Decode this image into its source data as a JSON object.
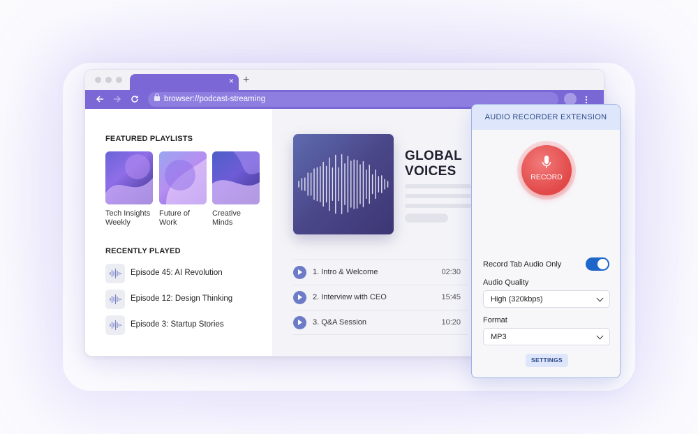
{
  "browser": {
    "url": "browser://podcast-streaming",
    "nav_icons": [
      "back-arrow-icon",
      "forward-arrow-icon",
      "reload-icon"
    ],
    "tab_close": "×",
    "new_tab": "+"
  },
  "featured": {
    "heading": "FEATURED PLAYLISTS",
    "items": [
      {
        "line1": "Tech Insights",
        "line2": "Weekly"
      },
      {
        "line1": "Future of",
        "line2": "Work"
      },
      {
        "line1": "Creative",
        "line2": "Minds"
      }
    ]
  },
  "recent": {
    "heading": "RECENTLY PLAYED",
    "items": [
      {
        "label": "Episode 45: AI Revolution"
      },
      {
        "label": "Episode 12: Design Thinking"
      },
      {
        "label": "Episode 3: Startup Stories"
      }
    ]
  },
  "podcast": {
    "title_line1": "GLOBAL",
    "title_line2": "VOICES",
    "episodes": [
      {
        "label": "1. Intro & Welcome",
        "duration": "02:30"
      },
      {
        "label": "2. Interview with CEO",
        "duration": "15:45"
      },
      {
        "label": "3. Q&A Session",
        "duration": "10:20"
      }
    ]
  },
  "extension": {
    "title": "AUDIO RECORDER EXTENSION",
    "record_label": "RECORD",
    "tab_audio_label": "Record Tab Audio Only",
    "tab_audio_on": true,
    "quality_label": "Audio Quality",
    "quality_value": "High (320kbps)",
    "format_label": "Format",
    "format_value": "MP3",
    "settings_label": "SETTINGS",
    "colors": {
      "record": "#e24848",
      "toggle": "#1e66c9",
      "accent": "#7b68d6"
    }
  }
}
